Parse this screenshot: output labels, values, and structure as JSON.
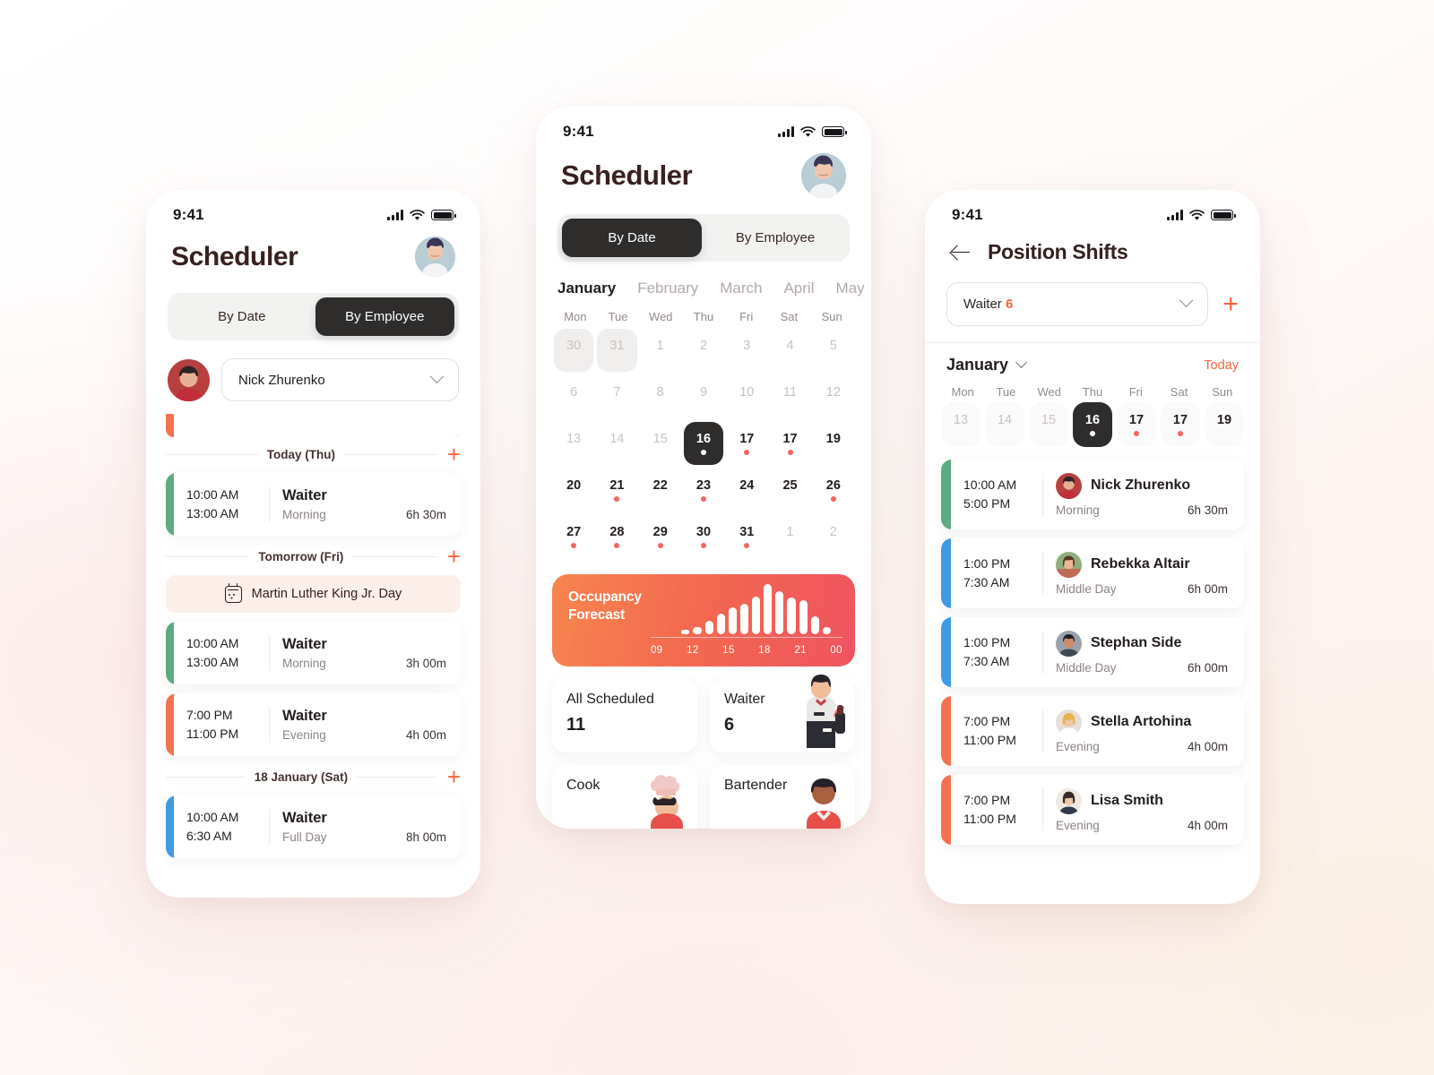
{
  "colors": {
    "accent": "#f4643f",
    "dark": "#2f2c2c",
    "green": "#5cab82",
    "blue": "#3e9ae4",
    "orange": "#f4714f",
    "dot": "#f4645f",
    "gradient_from": "#f7854e",
    "gradient_to": "#ef5460"
  },
  "status_bar": {
    "time": "9:41",
    "signal_icon": "cellular-bars-icon",
    "wifi_icon": "wifi-icon",
    "battery_icon": "battery-icon"
  },
  "phone_left": {
    "title": "Scheduler",
    "avatar_icon": "user-avatar",
    "segment": {
      "options": [
        "By Date",
        "By Employee"
      ],
      "active": "By Employee"
    },
    "employee_picker": {
      "value": "Nick Zhurenko",
      "avatar_icon": "employee-avatar",
      "chevron_icon": "chevron-down-icon"
    },
    "groups": [
      {
        "label": "Today (Thu)",
        "add_label": "+",
        "holiday": null,
        "shifts": [
          {
            "start": "10:00 AM",
            "end": "13:00 AM",
            "role": "Waiter",
            "period": "Morning",
            "duration": "6h 30m",
            "color": "#5cab82"
          }
        ]
      },
      {
        "label": "Tomorrow (Fri)",
        "add_label": "+",
        "holiday": {
          "icon": "calendar-icon",
          "label": "Martin Luther King Jr. Day"
        },
        "shifts": [
          {
            "start": "10:00 AM",
            "end": "13:00 AM",
            "role": "Waiter",
            "period": "Morning",
            "duration": "3h 00m",
            "color": "#5cab82"
          },
          {
            "start": "7:00 PM",
            "end": "11:00 PM",
            "role": "Waiter",
            "period": "Evening",
            "duration": "4h 00m",
            "color": "#f4714f"
          }
        ]
      },
      {
        "label": "18 January (Sat)",
        "add_label": "+",
        "holiday": null,
        "shifts": [
          {
            "start": "10:00 AM",
            "end": "6:30 AM",
            "role": "Waiter",
            "period": "Full Day",
            "duration": "8h 00m",
            "color": "#3e9ae4"
          }
        ]
      }
    ]
  },
  "phone_center": {
    "title": "Scheduler",
    "avatar_icon": "user-avatar",
    "segment": {
      "options": [
        "By Date",
        "By Employee"
      ],
      "active": "By Date"
    },
    "months": [
      "January",
      "February",
      "March",
      "April",
      "May"
    ],
    "active_month": "January",
    "weekday_headers": [
      "Mon",
      "Tue",
      "Wed",
      "Thu",
      "Fri",
      "Sat",
      "Sun"
    ],
    "calendar": [
      [
        {
          "d": "30",
          "s": "shaded muted"
        },
        {
          "d": "31",
          "s": "shaded muted"
        },
        {
          "d": "1",
          "s": "muted"
        },
        {
          "d": "2",
          "s": "muted"
        },
        {
          "d": "3",
          "s": "muted"
        },
        {
          "d": "4",
          "s": "muted"
        },
        {
          "d": "5",
          "s": "muted"
        }
      ],
      [
        {
          "d": "6",
          "s": "muted"
        },
        {
          "d": "7",
          "s": "muted"
        },
        {
          "d": "8",
          "s": "muted"
        },
        {
          "d": "9",
          "s": "muted"
        },
        {
          "d": "10",
          "s": "muted"
        },
        {
          "d": "11",
          "s": "muted"
        },
        {
          "d": "12",
          "s": "muted"
        }
      ],
      [
        {
          "d": "13",
          "s": "muted"
        },
        {
          "d": "14",
          "s": "muted"
        },
        {
          "d": "15",
          "s": "muted"
        },
        {
          "d": "16",
          "s": "selected",
          "dot": true
        },
        {
          "d": "17",
          "s": "",
          "dot": true
        },
        {
          "d": "17",
          "s": "",
          "dot": true
        },
        {
          "d": "19",
          "s": ""
        }
      ],
      [
        {
          "d": "20",
          "s": ""
        },
        {
          "d": "21",
          "s": "",
          "dot": true
        },
        {
          "d": "22",
          "s": ""
        },
        {
          "d": "23",
          "s": "",
          "dot": true
        },
        {
          "d": "24",
          "s": ""
        },
        {
          "d": "25",
          "s": ""
        },
        {
          "d": "26",
          "s": "",
          "dot": true
        }
      ],
      [
        {
          "d": "27",
          "s": "",
          "dot": true
        },
        {
          "d": "28",
          "s": "",
          "dot": true
        },
        {
          "d": "29",
          "s": "",
          "dot": true
        },
        {
          "d": "30",
          "s": "",
          "dot": true
        },
        {
          "d": "31",
          "s": "",
          "dot": true
        },
        {
          "d": "1",
          "s": "muted"
        },
        {
          "d": "2",
          "s": "muted"
        }
      ]
    ],
    "occupancy": {
      "title_line1": "Occupancy",
      "title_line2": "Forecast"
    },
    "stats": [
      {
        "name": "All Scheduled",
        "value": "11",
        "figure_icon": null
      },
      {
        "name": "Waiter",
        "value": "6",
        "figure_icon": "waiter-illustration"
      },
      {
        "name": "Cook",
        "value": "",
        "figure_icon": "cook-illustration"
      },
      {
        "name": "Bartender",
        "value": "",
        "figure_icon": "bartender-illustration"
      }
    ]
  },
  "phone_right": {
    "back_icon": "back-arrow-icon",
    "title": "Position Shifts",
    "position_picker": {
      "label": "Waiter",
      "count": "6",
      "chevron_icon": "chevron-down-icon",
      "add_label": "+"
    },
    "month": "January",
    "today_label": "Today",
    "weekday_headers": [
      "Mon",
      "Tue",
      "Wed",
      "Thu",
      "Fri",
      "Sat",
      "Sun"
    ],
    "week": [
      {
        "d": "13",
        "s": "muted"
      },
      {
        "d": "14",
        "s": "muted"
      },
      {
        "d": "15",
        "s": "muted"
      },
      {
        "d": "16",
        "s": "selected",
        "dot": true
      },
      {
        "d": "17",
        "s": "",
        "dot": true
      },
      {
        "d": "17",
        "s": "",
        "dot": true
      },
      {
        "d": "19",
        "s": ""
      }
    ],
    "shifts": [
      {
        "start": "10:00 AM",
        "end": "5:00 PM",
        "name": "Nick Zhurenko",
        "period": "Morning",
        "duration": "6h 30m",
        "color": "#5cab82",
        "avatar_icon": "avatar-nick"
      },
      {
        "start": "1:00 PM",
        "end": "7:30 AM",
        "name": "Rebekka Altair",
        "period": "Middle Day",
        "duration": "6h 00m",
        "color": "#3e9ae4",
        "avatar_icon": "avatar-rebekka"
      },
      {
        "start": "1:00 PM",
        "end": "7:30 AM",
        "name": "Stephan Side",
        "period": "Middle Day",
        "duration": "6h 00m",
        "color": "#3e9ae4",
        "avatar_icon": "avatar-stephan"
      },
      {
        "start": "7:00 PM",
        "end": "11:00 PM",
        "name": "Stella Artohina",
        "period": "Evening",
        "duration": "4h 00m",
        "color": "#f4714f",
        "avatar_icon": "avatar-stella"
      },
      {
        "start": "7:00 PM",
        "end": "11:00 PM",
        "name": "Lisa Smith",
        "period": "Evening",
        "duration": "4h 00m",
        "color": "#f4714f",
        "avatar_icon": "avatar-lisa"
      }
    ]
  },
  "chart_data": {
    "type": "bar",
    "title": "Occupancy Forecast",
    "xlabel": "",
    "ylabel": "",
    "tick_labels": [
      "09",
      "12",
      "15",
      "18",
      "21",
      "00"
    ],
    "x": [
      "09",
      "10",
      "11",
      "12",
      "13",
      "14",
      "15",
      "16",
      "17",
      "18",
      "19",
      "20",
      "21",
      "22",
      "23",
      "00"
    ],
    "values": [
      0,
      0,
      8,
      12,
      22,
      34,
      44,
      50,
      62,
      82,
      70,
      60,
      56,
      30,
      12,
      0
    ],
    "ylim": [
      0,
      100
    ],
    "grid": false,
    "legend": false
  }
}
